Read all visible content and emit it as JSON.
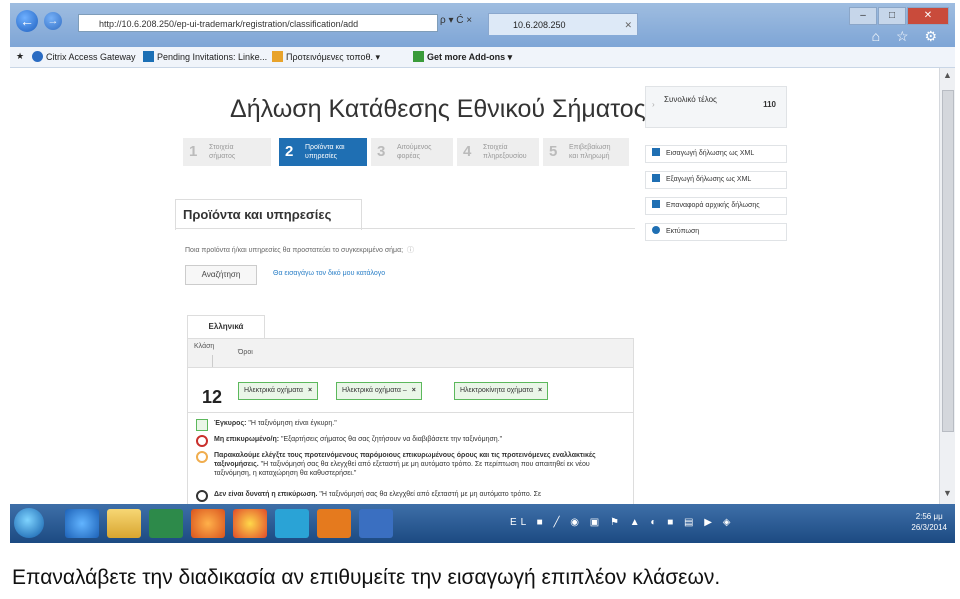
{
  "browser": {
    "address": "http://10.6.208.250/ep-ui-trademark/registration/classification/add",
    "tab_title": "10.6.208.250",
    "search_controls": "ρ ▾ Ć ×",
    "back_label": "←",
    "forward_label": "→",
    "window_controls": [
      "–",
      "□",
      "✕"
    ],
    "tool_icons": "⌂ ☆ ⚙"
  },
  "favorites": [
    {
      "label": "Citrix Access Gateway",
      "color": "#2a6bc2"
    },
    {
      "label": "Pending Invitations: Linke...",
      "color": "#1b6fb5"
    },
    {
      "label": "Προτεινόμενες τοποθ. ▾",
      "color": "#e8a32b"
    },
    {
      "label": "Get more Add-ons ▾",
      "color": "#3a9b3a"
    }
  ],
  "page": {
    "title": "Δήλωση Κατάθεσης Εθνικού Σήματος",
    "steps": [
      {
        "num": "1",
        "label": "Στοιχεία σήματος"
      },
      {
        "num": "2",
        "label": "Προϊόντα και υπηρεσίες"
      },
      {
        "num": "3",
        "label": "Αιτούμενος φορέας"
      },
      {
        "num": "4",
        "label": "Στοιχεία πληρεξουσίου"
      },
      {
        "num": "5",
        "label": "Επιβεβαίωση και πληρωμή"
      }
    ],
    "section_title": "Προϊόντα και υπηρεσίες",
    "question": "Ποια προϊόντα ή/και υπηρεσίες θα προστατεύει το συγκεκριμένο σήμα;",
    "search_button": "Αναζήτηση",
    "link": "Θα εισαγάγω τον δικό μου κατάλογο",
    "lang_tab": "Ελληνικά",
    "col_class": "Κλάση",
    "col_terms": "Όροι",
    "class_number": "12",
    "chips": [
      "Ηλεκτρικά οχήματα",
      "Ηλεκτρικά οχήματα –",
      "Ηλεκτροκίνητα οχήματα"
    ],
    "chip_remove": "×",
    "messages": [
      {
        "bold": "Έγκυρος:",
        "text": " \"Η ταξινόμηση είναι έγκυρη.\"",
        "color": "#5cb85c"
      },
      {
        "bold": "Μη επικυρωμένο/η:",
        "text": " \"Εξαρτήσεις σήματος θα σας ζητήσουν να διαβιβάσετε την ταξινόμηση.\"",
        "color": "#c9302c"
      },
      {
        "bold": "Παρακαλούμε ελέγξτε τους προτεινόμενους παρόμοιους επικυρωμένους όρους και τις προτεινόμενες εναλλακτικές ταξινομήσεις.",
        "text": " \"Η ταξινόμησή σας θα ελεγχθεί από εξεταστή με μη αυτόματο τρόπο. Σε περίπτωση που απαιτηθεί εκ νέου ταξινόμηση, η καταχώρηση θα καθυστερήσει.\"",
        "color": "#f0ad4e"
      },
      {
        "bold": "Δεν είναι δυνατή η επικύρωση.",
        "text": " \"Η ταξινόμησή σας θα ελεγχθεί από εξεταστή με μη αυτόματο τρόπο. Σε",
        "color": "#333333"
      }
    ]
  },
  "sidebar": {
    "total_label": "Συνολικό τέλος",
    "total_value": "110",
    "buttons": [
      "Εισαγωγή δήλωσης ως XML",
      "Εξαγωγή δήλωσης ως XML",
      "Επαναφορά αρχικής δήλωσης",
      "Εκτύπωση"
    ]
  },
  "taskbar": {
    "tray": "EL ■ ╱ ◉ ▣ ⚑ ▲ ◐ ■ ▤ ▶ ◈",
    "time": "2:56 μμ",
    "date": "26/3/2014"
  },
  "caption": "Επαναλάβετε την διαδικασία αν επιθυμείτε την εισαγωγή επιπλέον κλάσεων."
}
